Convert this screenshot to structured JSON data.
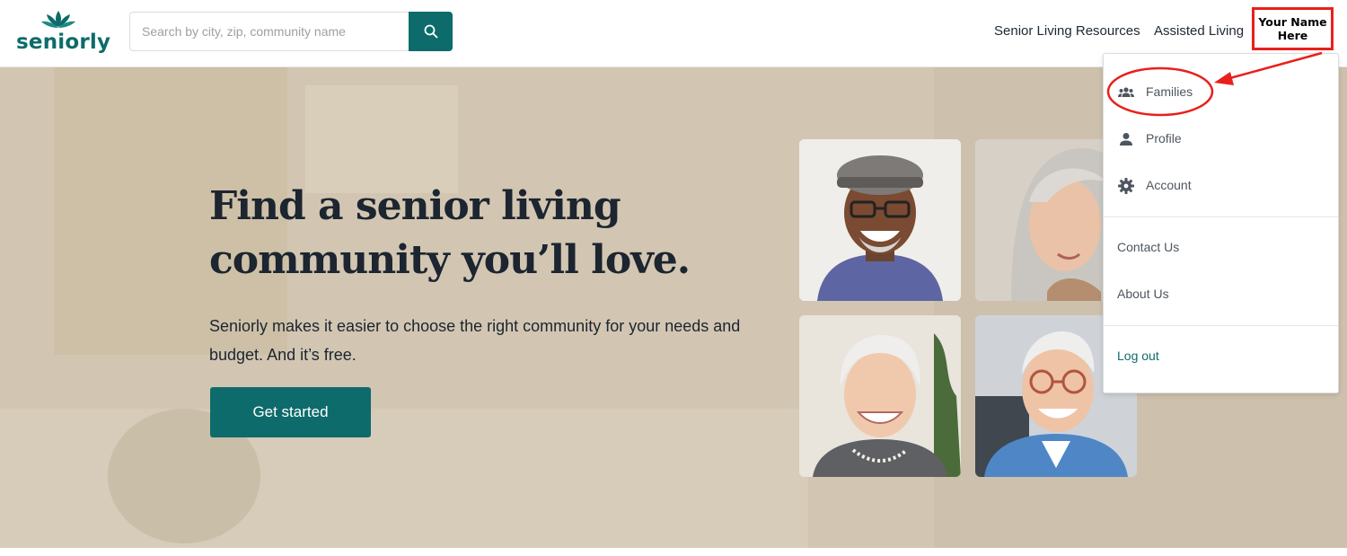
{
  "header": {
    "logo_text": "seniorly",
    "search": {
      "placeholder": "Search by city, zip, community name",
      "value": "",
      "button_icon": "search-icon"
    },
    "nav": [
      "Senior Living Resources",
      "Assisted Living"
    ],
    "user_label": "Your Name Here"
  },
  "hero": {
    "title": "Find a senior living community you’ll love.",
    "subtitle": "Seniorly makes it easier to choose the right community for your needs and budget. And it’s free.",
    "cta": "Get started"
  },
  "dropdown": {
    "items": [
      {
        "label": "Families",
        "icon": "families-icon"
      },
      {
        "label": "Profile",
        "icon": "person-icon"
      },
      {
        "label": "Account",
        "icon": "gear-icon"
      },
      {
        "label": "Contact Us"
      },
      {
        "label": "About Us"
      },
      {
        "label": "Log out"
      }
    ]
  },
  "colors": {
    "brand": "#0e6b6b",
    "annotation": "#e8201b",
    "hero_bg": "#d2c6b2"
  }
}
